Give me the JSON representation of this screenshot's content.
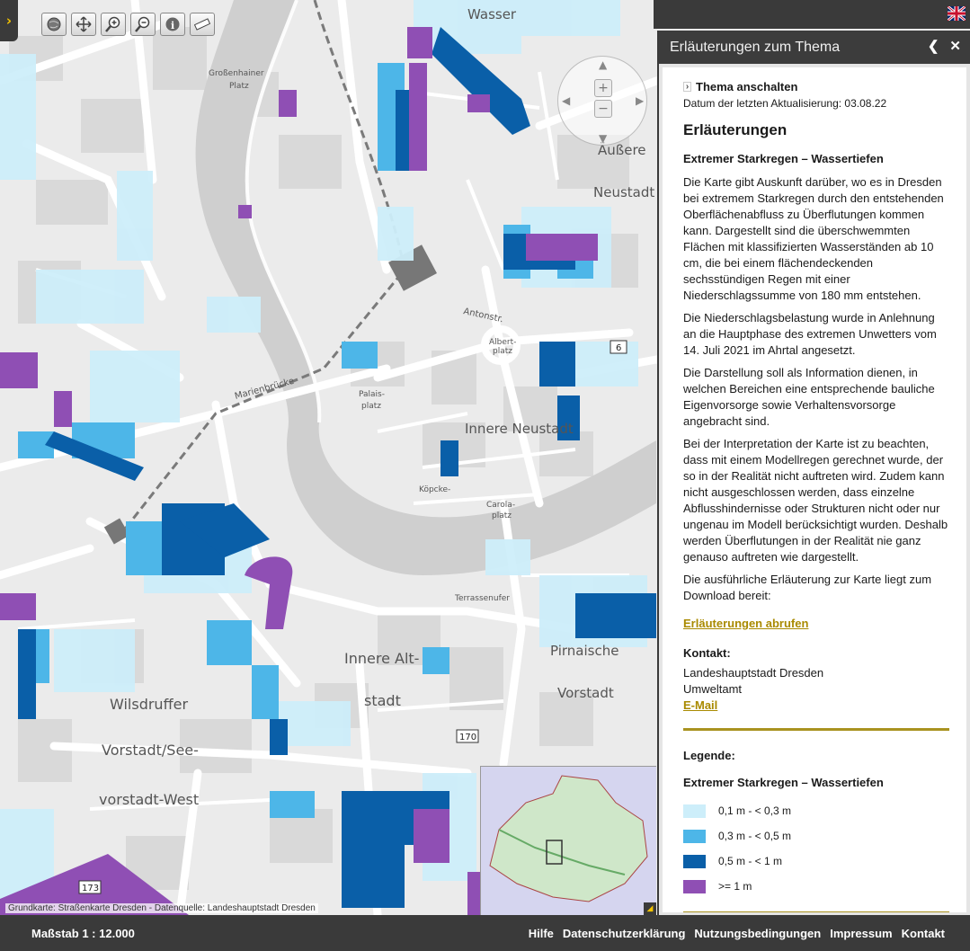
{
  "map": {
    "attribution": "Grundkarte: Straßenkarte Dresden - Datenquelle: Landeshauptstadt Dresden",
    "labels": {
      "district_innere_neustadt": "Innere Neustadt",
      "district_innere_alt": "Innere Alt-",
      "district_stadt": "stadt",
      "district_wilsdruffer": "Wilsdruffer",
      "district_vorstadt_see": "Vorstadt/See-",
      "district_vorstadt_west": "vorstadt-West",
      "district_pirnaische": "Pirnaische",
      "district_vorstadt": "Vorstadt",
      "district_aeussere": "Äußere",
      "district_neustadt": "Neustadt",
      "district_wasser": "Wasser",
      "street_marienbruecke": "Marienbrücke",
      "street_antonstr": "Antonstr.",
      "street_albertplatz": "Albert-",
      "street_albertplatz2": "platz",
      "street_palais": "Palais-",
      "street_palais2": "platz",
      "street_carola": "Carola-",
      "street_carola2": "platz",
      "street_koepcke": "Köpcke-",
      "street_terrassenufer": "Terrassenufer",
      "street_grossenhainer": "Großenhainer",
      "street_platz": "Platz",
      "road_170": "170",
      "road_173": "173",
      "road_6": "6"
    },
    "colors": {
      "depth_1": "#cdeefa",
      "depth_2": "#4db6e8",
      "depth_3": "#0a5fa8",
      "depth_4": "#8f4fb4",
      "water": "#cfcfcf",
      "block": "#bdbdbd"
    },
    "tools": [
      "globe-icon",
      "pan-icon",
      "zoom-in-icon",
      "zoom-out-icon",
      "info-icon",
      "measure-icon"
    ]
  },
  "header": {
    "flag_icon": "uk-flag-icon"
  },
  "panel": {
    "title": "Erläuterungen zum Thema",
    "toggle_label": "Thema anschalten",
    "date_line": "Datum der letzten Aktualisierung: 03.08.22",
    "heading": "Erläuterungen",
    "subheading": "Extremer Starkregen – Wassertiefen",
    "paragraphs": [
      "Die Karte gibt Auskunft darüber, wo es in Dresden bei extremem Starkregen durch den entstehenden Oberflächenabfluss zu Überflutungen kommen kann. Dargestellt sind die überschwemmten Flächen mit klassifizierten Wasserständen ab 10 cm, die bei einem flächendeckenden sechsstündigen Regen mit einer Niederschlagssumme von 180 mm entstehen.",
      "Die Niederschlagsbelastung wurde in Anlehnung an die Hauptphase des extremen Unwetters vom 14. Juli 2021 im Ahrtal angesetzt.",
      "Die Darstellung soll als Information dienen, in welchen Bereichen eine entsprechende bauliche Eigenvorsorge sowie Verhaltensvorsorge angebracht sind.",
      "Bei der Interpretation der Karte ist zu beachten, dass mit einem Modellregen gerechnet wurde, der so in der Realität nicht auftreten wird. Zudem kann nicht ausgeschlossen werden, dass einzelne Abflusshindernisse oder Strukturen nicht oder nur ungenau im Modell berücksichtigt wurden. Deshalb werden Überflutungen in der Realität nie ganz genauso auftreten wie dargestellt.",
      "Die ausführliche Erläuterung zur Karte liegt zum Download bereit:"
    ],
    "download_link": "Erläuterungen abrufen",
    "contact_heading": "Kontakt:",
    "contact_lines": [
      "Landeshauptstadt Dresden",
      "Umweltamt"
    ],
    "email_link": "E-Mail",
    "legend_heading": "Legende:",
    "legend_subheading": "Extremer Starkregen – Wassertiefen",
    "legend": [
      {
        "label": "0,1 m - < 0,3 m",
        "color": "#cdeefa"
      },
      {
        "label": "0,3 m - < 0,5 m",
        "color": "#4db6e8"
      },
      {
        "label": "0,5 m - < 1 m",
        "color": "#0a5fa8"
      },
      {
        "label": ">= 1 m",
        "color": "#8f4fb4"
      }
    ]
  },
  "footer": {
    "scale": "Maßstab 1 : 12.000",
    "links": [
      "Hilfe",
      "Datenschutzerklärung",
      "Nutzungsbedingungen",
      "Impressum",
      "Kontakt"
    ]
  }
}
